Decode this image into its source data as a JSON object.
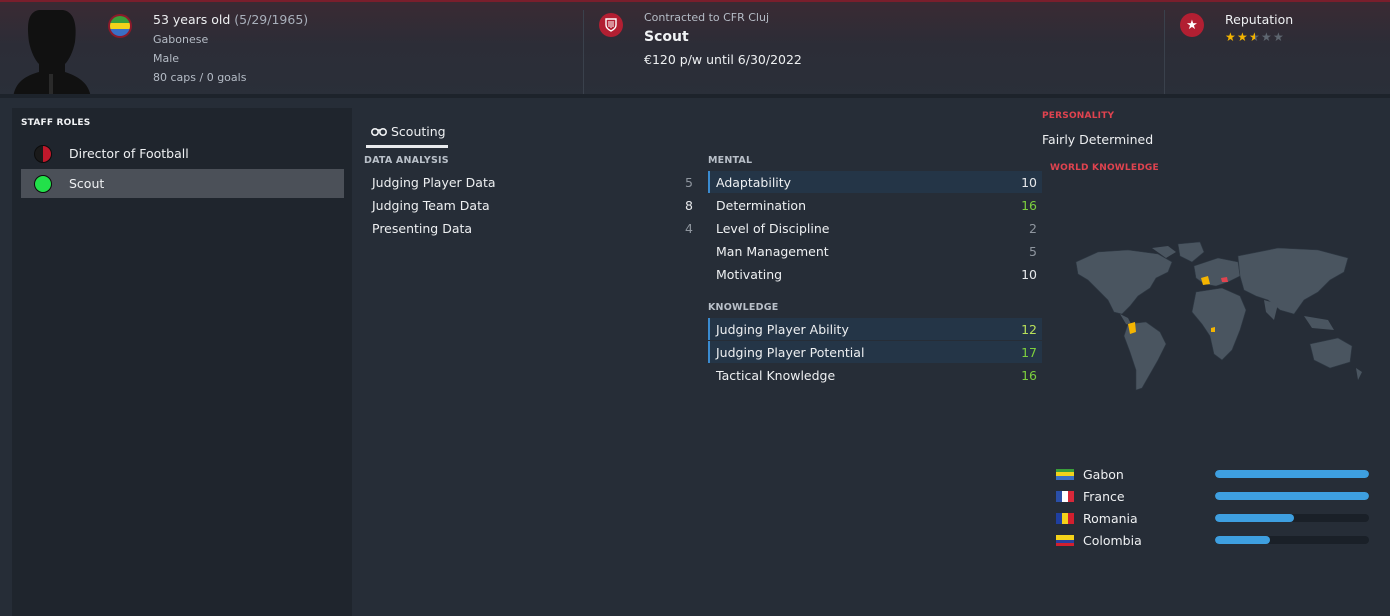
{
  "header": {
    "age_text": "53 years old",
    "birth_date": "(5/29/1965)",
    "nationality": "Gabonese",
    "gender": "Male",
    "caps": "80 caps / 0 goals",
    "contract_label": "Contracted to CFR Cluj",
    "role": "Scout",
    "wage": "€120 p/w until 6/30/2022",
    "reputation_label": "Reputation",
    "reputation_stars": 2.5,
    "reputation_max": 5
  },
  "staff_roles": {
    "title": "STAFF ROLES",
    "items": [
      {
        "label": "Director of Football",
        "icon": "half-red-dot-icon",
        "selected": false
      },
      {
        "label": "Scout",
        "icon": "green-dot-icon",
        "selected": true
      }
    ]
  },
  "tabs": [
    {
      "label": "Scouting",
      "icon": "binoculars-icon"
    }
  ],
  "data_analysis": {
    "title": "DATA ANALYSIS",
    "items": [
      {
        "name": "Judging Player Data",
        "value": "5"
      },
      {
        "name": "Judging Team Data",
        "value": "8"
      },
      {
        "name": "Presenting Data",
        "value": "4"
      }
    ]
  },
  "mental": {
    "title": "MENTAL",
    "items": [
      {
        "name": "Adaptability",
        "value": "10"
      },
      {
        "name": "Determination",
        "value": "16"
      },
      {
        "name": "Level of Discipline",
        "value": "2"
      },
      {
        "name": "Man Management",
        "value": "5"
      },
      {
        "name": "Motivating",
        "value": "10"
      }
    ]
  },
  "knowledge": {
    "title": "KNOWLEDGE",
    "items": [
      {
        "name": "Judging Player Ability",
        "value": "12"
      },
      {
        "name": "Judging Player Potential",
        "value": "17"
      },
      {
        "name": "Tactical Knowledge",
        "value": "16"
      }
    ]
  },
  "personality": {
    "title": "PERSONALITY",
    "value": "Fairly Determined"
  },
  "world_knowledge": {
    "title": "WORLD KNOWLEDGE",
    "countries": [
      {
        "name": "Gabon",
        "level": 1.0
      },
      {
        "name": "France",
        "level": 1.0
      },
      {
        "name": "Romania",
        "level": 0.51
      },
      {
        "name": "Colombia",
        "level": 0.36
      }
    ]
  },
  "colors": {
    "accent_red": "#b21f32",
    "highlight_blue": "#3a8bd0",
    "bar_blue": "#3e9fe0",
    "attr_green": "#7ccf3e"
  }
}
